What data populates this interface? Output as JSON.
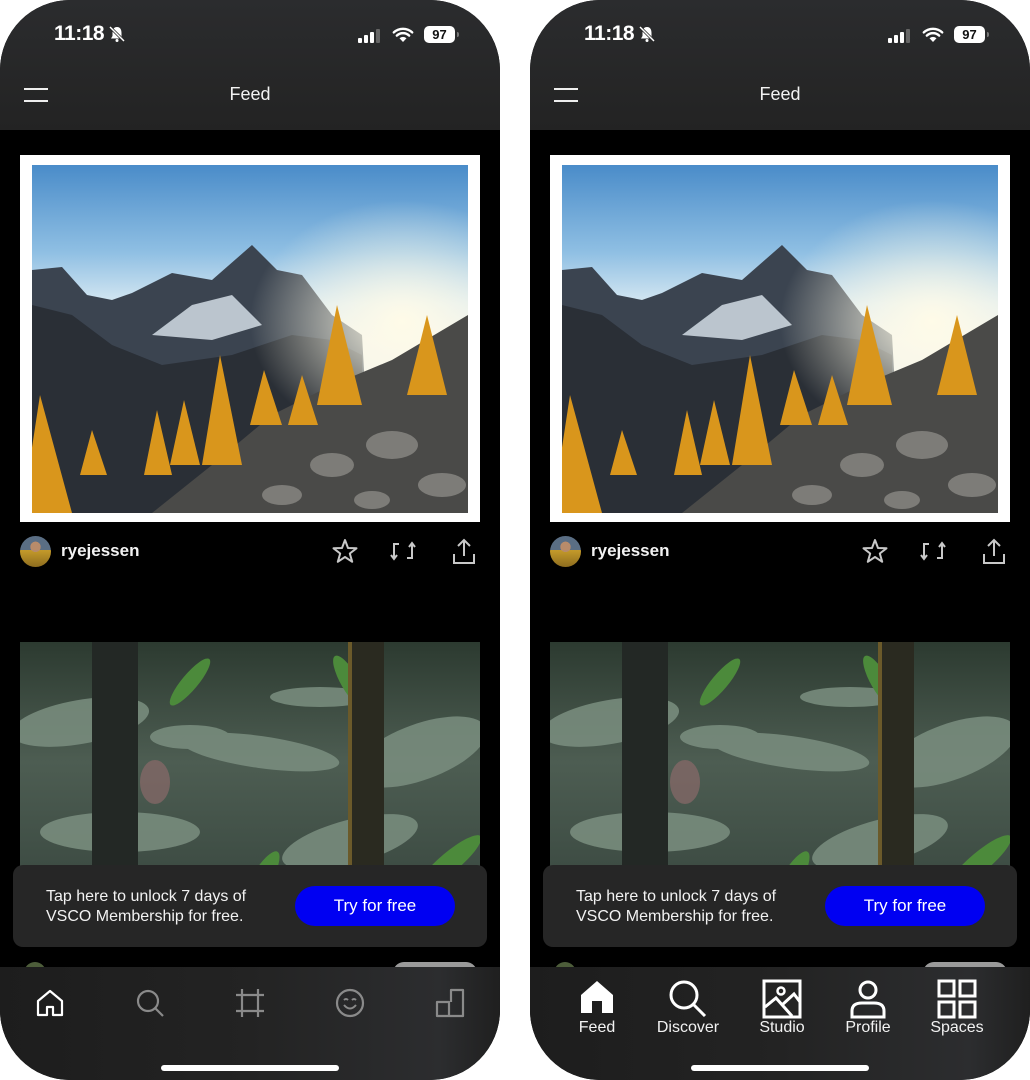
{
  "phones": [
    {
      "variant": "icon-only-tabbar",
      "status_bar": {
        "time": "11:18",
        "battery": "97",
        "silent": true
      },
      "header": {
        "title": "Feed",
        "menu_icon": "hamburger-icon"
      },
      "posts": [
        {
          "photo": "mountain landscape with golden larch trees",
          "username": "ryejessen",
          "actions": [
            "star-icon",
            "repost-icon",
            "share-icon"
          ]
        },
        {
          "photo": "fern forest with tree trunks"
        }
      ],
      "promo": {
        "text": "Tap here to unlock 7 days of VSCO Membership for free.",
        "button_label": "Try for free",
        "button_color": "#0000f2"
      },
      "tabs": [
        {
          "icon": "home-icon",
          "label": "",
          "active": true
        },
        {
          "icon": "search-icon",
          "label": "",
          "active": false
        },
        {
          "icon": "crop-icon",
          "label": "",
          "active": false
        },
        {
          "icon": "smiley-icon",
          "label": "",
          "active": false
        },
        {
          "icon": "spaces-icon",
          "label": "",
          "active": false
        }
      ]
    },
    {
      "variant": "labeled-tabbar",
      "status_bar": {
        "time": "11:18",
        "battery": "97",
        "silent": true
      },
      "header": {
        "title": "Feed",
        "menu_icon": "hamburger-icon"
      },
      "posts": [
        {
          "photo": "mountain landscape with golden larch trees",
          "username": "ryejessen",
          "actions": [
            "star-icon",
            "repost-icon",
            "share-icon"
          ]
        },
        {
          "photo": "fern forest with tree trunks"
        }
      ],
      "promo": {
        "text": "Tap here to unlock 7 days of VSCO Membership for free.",
        "button_label": "Try for free",
        "button_color": "#0000f2"
      },
      "tabs": [
        {
          "icon": "home-icon",
          "label": "Feed",
          "active": true
        },
        {
          "icon": "search-icon",
          "label": "Discover",
          "active": false
        },
        {
          "icon": "image-icon",
          "label": "Studio",
          "active": false
        },
        {
          "icon": "person-icon",
          "label": "Profile",
          "active": false
        },
        {
          "icon": "grid-icon",
          "label": "Spaces",
          "active": false
        }
      ]
    }
  ],
  "colors": {
    "header_bg": "#262626",
    "feed_bg": "#000000",
    "promo_bg": "#262626",
    "accent_blue": "#0000f2",
    "icon_active": "#ffffff",
    "icon_inactive": "#8a8a8a"
  }
}
